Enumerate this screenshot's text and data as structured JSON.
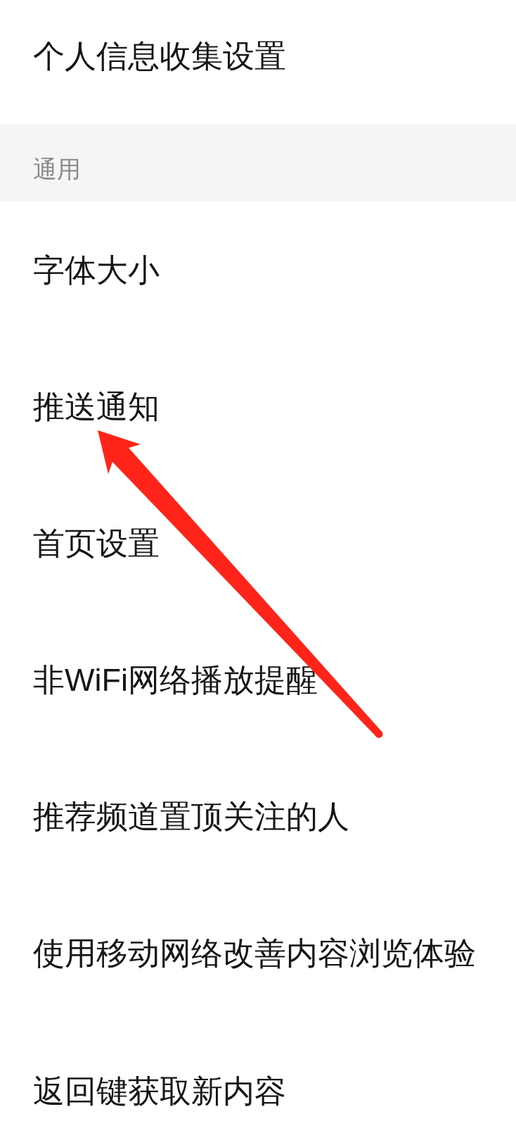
{
  "settings_list": [
    {
      "kind": "item",
      "label": "个人信息收集设置"
    },
    {
      "kind": "section_header",
      "label": "通用"
    },
    {
      "kind": "item",
      "label": "字体大小"
    },
    {
      "kind": "item",
      "label": "推送通知"
    },
    {
      "kind": "item",
      "label": "首页设置"
    },
    {
      "kind": "item",
      "label": "非WiFi网络播放提醒"
    },
    {
      "kind": "item",
      "label": "推荐频道置顶关注的人"
    },
    {
      "kind": "item",
      "label": "使用移动网络改善内容浏览体验"
    },
    {
      "kind": "item",
      "label": "返回键获取新内容"
    }
  ]
}
